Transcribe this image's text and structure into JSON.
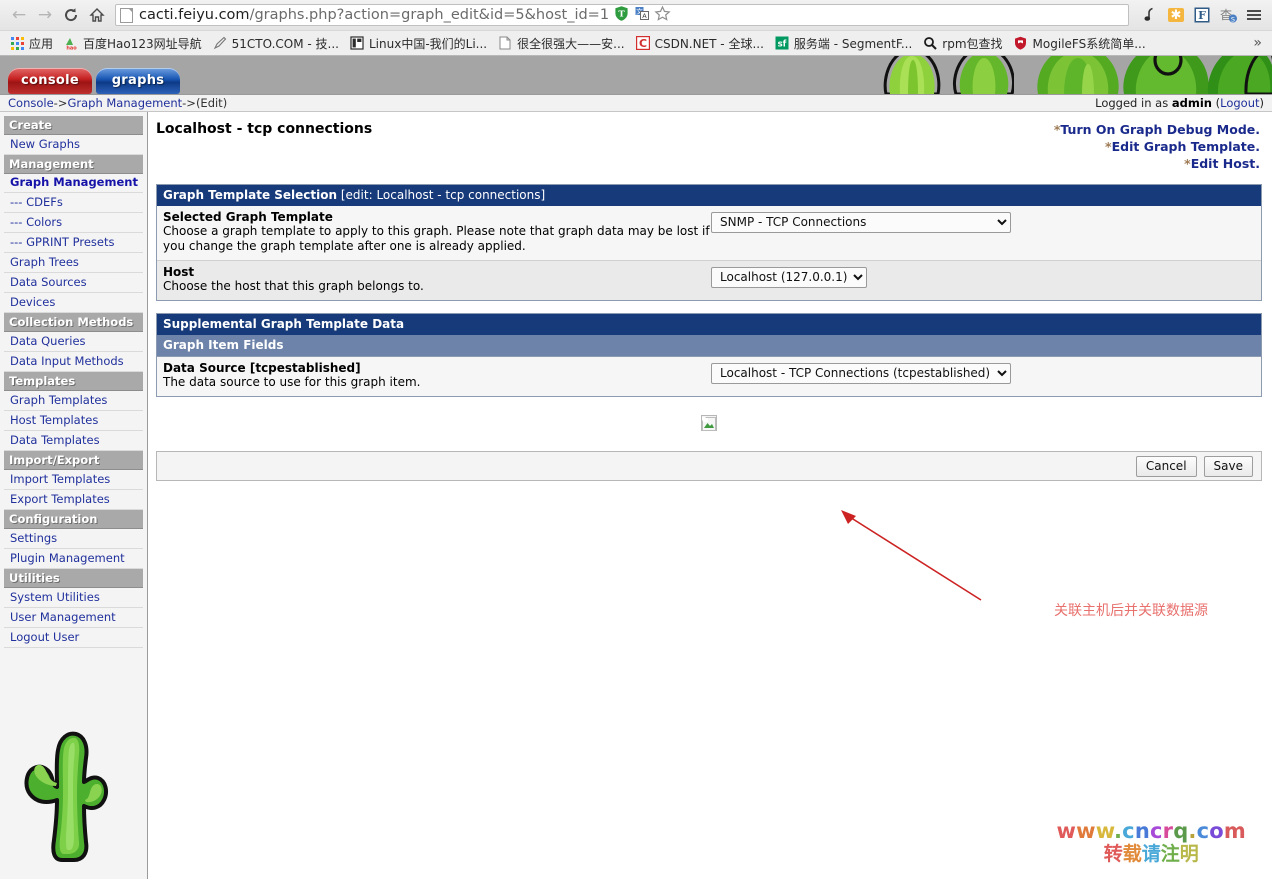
{
  "browser": {
    "nav": {
      "back_icon": "arrow-left-icon",
      "forward_icon": "arrow-right-icon",
      "reload_icon": "reload-icon",
      "home_icon": "home-icon"
    },
    "url": "cacti.feiyu.com/graphs.php?action=graph_edit&id=5&host_id=1",
    "url_host": "cacti.feiyu.com",
    "url_path": "/graphs.php?action=graph_edit&id=5&host_id=1",
    "urlbar_icons": [
      "shield-t-icon",
      "translate-icon",
      "star-icon"
    ],
    "toolbar_icons": [
      "music-note-icon",
      "asterisk-icon",
      "f-box-icon",
      "dictionary-icon",
      "menu-icon"
    ],
    "bookmarks": [
      {
        "label": "应用",
        "icon": "apps-grid-icon"
      },
      {
        "label": "百度Hao123网址导航",
        "icon": "hao123-icon"
      },
      {
        "label": "51CTO.COM - 技...",
        "icon": "pen-icon"
      },
      {
        "label": "Linux中国-我们的Li...",
        "icon": "book-icon"
      },
      {
        "label": "很全很强大——安...",
        "icon": "page-icon"
      },
      {
        "label": "CSDN.NET - 全球...",
        "icon": "csdn-icon"
      },
      {
        "label": "服务端 - SegmentF...",
        "icon": "segmentfault-icon"
      },
      {
        "label": "rpm包查找",
        "icon": "search-icon"
      },
      {
        "label": "MogileFS系统简单...",
        "icon": "shield-icon"
      }
    ],
    "bookmarks_overflow": "»"
  },
  "app": {
    "tabs": [
      {
        "label": "console",
        "color": "#c62222"
      },
      {
        "label": "graphs",
        "color": "#1a58b5"
      }
    ],
    "breadcrumb": {
      "console": "Console",
      "sep1": " -> ",
      "graph_management": "Graph Management",
      "sep2": " -> ",
      "current": "(Edit)"
    },
    "login": {
      "prefix": "Logged in as ",
      "user": "admin",
      "logout_open": " (",
      "logout": "Logout",
      "logout_close": ")"
    }
  },
  "sidebar": {
    "sections": [
      {
        "header": "Create",
        "items": [
          {
            "label": "New Graphs",
            "current": false
          }
        ]
      },
      {
        "header": "Management",
        "items": [
          {
            "label": "Graph Management",
            "current": true
          },
          {
            "label": "--- CDEFs",
            "current": false
          },
          {
            "label": "--- Colors",
            "current": false
          },
          {
            "label": "--- GPRINT Presets",
            "current": false
          },
          {
            "label": "Graph Trees",
            "current": false
          },
          {
            "label": "Data Sources",
            "current": false
          },
          {
            "label": "Devices",
            "current": false
          }
        ]
      },
      {
        "header": "Collection Methods",
        "items": [
          {
            "label": "Data Queries",
            "current": false
          },
          {
            "label": "Data Input Methods",
            "current": false
          }
        ]
      },
      {
        "header": "Templates",
        "items": [
          {
            "label": "Graph Templates",
            "current": false
          },
          {
            "label": "Host Templates",
            "current": false
          },
          {
            "label": "Data Templates",
            "current": false
          }
        ]
      },
      {
        "header": "Import/Export",
        "items": [
          {
            "label": "Import Templates",
            "current": false
          },
          {
            "label": "Export Templates",
            "current": false
          }
        ]
      },
      {
        "header": "Configuration",
        "items": [
          {
            "label": "Settings",
            "current": false
          },
          {
            "label": "Plugin Management",
            "current": false
          }
        ]
      },
      {
        "header": "Utilities",
        "items": [
          {
            "label": "System Utilities",
            "current": false
          },
          {
            "label": "User Management",
            "current": false
          },
          {
            "label": "Logout User",
            "current": false
          }
        ]
      }
    ],
    "logo_icon": "cactus-logo-icon"
  },
  "main": {
    "page_title": "Localhost - tcp connections",
    "action_links": [
      {
        "star": "*",
        "label": "Turn On Graph Debug Mode."
      },
      {
        "star": "*",
        "label": "Edit Graph Template."
      },
      {
        "star": "*",
        "label": "Edit Host."
      }
    ],
    "graph_template_selection": {
      "box_title": "Graph Template Selection",
      "box_title_sub": " [edit: Localhost - tcp connections]",
      "rows": [
        {
          "name": "Selected Graph Template",
          "desc": "Choose a graph template to apply to this graph. Please note that graph data may be lost if you change the graph template after one is already applied.",
          "value": "SNMP - TCP Connections"
        },
        {
          "name": "Host",
          "desc": "Choose the host that this graph belongs to.",
          "value": "Localhost (127.0.0.1)"
        }
      ]
    },
    "supplemental": {
      "box_title": "Supplemental Graph Template Data",
      "sub_title": "Graph Item Fields",
      "rows": [
        {
          "name": "Data Source [tcpestablished]",
          "desc": "The data source to use for this graph item.",
          "value": "Localhost - TCP Connections (tcpestablished)"
        }
      ]
    },
    "broken_image_icon": "broken-image-icon",
    "buttons": {
      "cancel": "Cancel",
      "save": "Save"
    },
    "annotation": {
      "text": "关联主机后并关联数据源",
      "color": "#e8706d"
    },
    "watermark": {
      "line1": "www.cncrq.com",
      "line2": "转载请注明",
      "line1_colors": [
        "#e05a5a",
        "#e07a3a",
        "#d8b83a",
        "#6fae4a",
        "#4aa8d8",
        "#4a7ad8",
        "#a84ad8",
        "#d84a9a",
        "#5a9a4a",
        "#b8a23a",
        "#4a8ad8",
        "#7a4ad8",
        "#d85a5a"
      ],
      "line2_colors": [
        "#e05a5a",
        "#e08a3a",
        "#4aa8d8",
        "#6fae4a",
        "#b8b84a"
      ]
    }
  },
  "colors": {
    "box_title_bg": "#173a7b",
    "sub_title_bg": "#6d83aa",
    "sidebar_header_bg": "#a9a9a9",
    "link": "#20309c",
    "banner_bg": "#a5a5a5"
  }
}
